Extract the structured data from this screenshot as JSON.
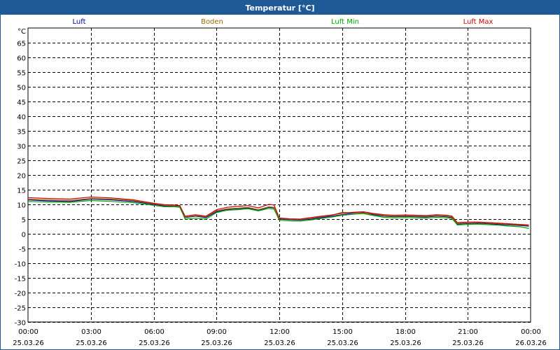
{
  "window": {
    "title": "Temperatur [°C]"
  },
  "colors": {
    "header_bg": "#1f5a96",
    "grid": "#000000",
    "luft": "#000099",
    "boden": "#996600",
    "luft_min": "#00aa00",
    "luft_max": "#cc0000"
  },
  "chart_data": {
    "type": "line",
    "title": "Temperatur [°C]",
    "ylabel": "°C",
    "ylim": [
      -30,
      70
    ],
    "yticks": [
      -30,
      -25,
      -20,
      -15,
      -10,
      -5,
      0,
      5,
      10,
      15,
      20,
      25,
      30,
      35,
      40,
      45,
      50,
      55,
      60,
      65
    ],
    "xlim": [
      "2026-03-25 00:00",
      "2026-03-26 00:00"
    ],
    "xticks": [
      {
        "time": "00:00",
        "date": "25.03.26"
      },
      {
        "time": "03:00",
        "date": "25.03.26"
      },
      {
        "time": "06:00",
        "date": "25.03.26"
      },
      {
        "time": "09:00",
        "date": "25.03.26"
      },
      {
        "time": "12:00",
        "date": "25.03.26"
      },
      {
        "time": "15:00",
        "date": "25.03.26"
      },
      {
        "time": "18:00",
        "date": "25.03.26"
      },
      {
        "time": "21:00",
        "date": "25.03.26"
      },
      {
        "time": "00:00",
        "date": "26.03.26"
      }
    ],
    "grid": true,
    "legend_position": "top",
    "series": [
      {
        "name": "Luft",
        "color": "#000099",
        "x": [
          "00:00",
          "01:00",
          "02:00",
          "03:00",
          "04:00",
          "05:00",
          "06:00",
          "06:30",
          "07:00",
          "07:15",
          "07:30",
          "08:00",
          "08:30",
          "09:00",
          "09:30",
          "10:00",
          "10:30",
          "11:00",
          "11:30",
          "11:45",
          "12:00",
          "12:30",
          "13:00",
          "13:30",
          "14:00",
          "14:30",
          "15:00",
          "15:30",
          "16:00",
          "16:30",
          "17:00",
          "17:30",
          "18:00",
          "18:30",
          "19:00",
          "19:30",
          "20:00",
          "20:15",
          "20:30",
          "21:00",
          "21:30",
          "22:00",
          "22:30",
          "23:00",
          "23:30",
          "23:55"
        ],
        "y": [
          11.5,
          11.2,
          11.0,
          11.8,
          11.5,
          11.0,
          10.0,
          9.5,
          9.5,
          9.3,
          5.5,
          6.0,
          5.5,
          7.5,
          8.3,
          8.5,
          8.8,
          8.0,
          9.0,
          8.8,
          5.0,
          4.8,
          4.7,
          5.0,
          5.5,
          6.0,
          6.5,
          7.0,
          7.2,
          6.5,
          6.0,
          5.8,
          5.9,
          5.8,
          5.7,
          6.0,
          5.8,
          5.5,
          3.3,
          3.5,
          3.6,
          3.4,
          3.2,
          3.0,
          2.8,
          2.6
        ]
      },
      {
        "name": "Boden",
        "color": "#996600",
        "x": [
          "00:00",
          "01:00",
          "02:00",
          "03:00",
          "04:00",
          "05:00",
          "06:00",
          "06:30",
          "07:00",
          "07:15",
          "07:30",
          "08:00",
          "08:30",
          "09:00",
          "09:30",
          "10:00",
          "10:30",
          "11:00",
          "11:30",
          "11:45",
          "12:00",
          "12:30",
          "13:00",
          "13:30",
          "14:00",
          "14:30",
          "15:00",
          "15:30",
          "16:00",
          "16:30",
          "17:00",
          "17:30",
          "18:00",
          "18:30",
          "19:00",
          "19:30",
          "20:00",
          "20:15",
          "20:30",
          "21:00",
          "21:30",
          "22:00",
          "22:30",
          "23:00",
          "23:30",
          "23:55"
        ],
        "y": [
          11.8,
          11.5,
          11.3,
          12.0,
          11.8,
          11.3,
          10.2,
          9.7,
          9.6,
          9.4,
          5.7,
          6.2,
          5.8,
          7.8,
          8.5,
          8.7,
          9.0,
          8.2,
          9.2,
          9.0,
          5.2,
          5.0,
          4.9,
          5.2,
          5.8,
          6.3,
          7.3,
          7.2,
          7.0,
          6.8,
          6.2,
          6.0,
          6.1,
          6.0,
          5.9,
          6.2,
          6.0,
          5.7,
          3.5,
          3.7,
          3.8,
          3.6,
          3.4,
          3.2,
          3.0,
          2.8
        ]
      },
      {
        "name": "Luft Min",
        "color": "#00aa00",
        "x": [
          "00:00",
          "01:00",
          "02:00",
          "03:00",
          "04:00",
          "05:00",
          "06:00",
          "06:30",
          "07:00",
          "07:15",
          "07:30",
          "08:00",
          "08:30",
          "09:00",
          "09:30",
          "10:00",
          "10:30",
          "11:00",
          "11:30",
          "11:45",
          "12:00",
          "12:30",
          "13:00",
          "13:30",
          "14:00",
          "14:30",
          "15:00",
          "15:30",
          "16:00",
          "16:30",
          "17:00",
          "17:30",
          "18:00",
          "18:30",
          "19:00",
          "19:30",
          "20:00",
          "20:15",
          "20:30",
          "21:00",
          "21:30",
          "22:00",
          "22:30",
          "23:00",
          "23:30",
          "23:55"
        ],
        "y": [
          11.0,
          10.8,
          10.7,
          11.3,
          11.0,
          10.6,
          9.7,
          9.2,
          9.2,
          9.0,
          5.0,
          5.3,
          5.0,
          7.2,
          8.0,
          8.2,
          8.5,
          7.8,
          8.6,
          8.4,
          4.6,
          4.4,
          4.3,
          4.7,
          5.2,
          5.7,
          6.3,
          6.6,
          6.9,
          6.2,
          5.6,
          5.4,
          5.5,
          5.4,
          5.3,
          5.6,
          5.4,
          5.2,
          3.0,
          3.2,
          3.3,
          3.1,
          2.9,
          2.6,
          2.4,
          1.8
        ]
      },
      {
        "name": "Luft Max",
        "color": "#cc0000",
        "x": [
          "00:00",
          "01:00",
          "02:00",
          "03:00",
          "04:00",
          "05:00",
          "06:00",
          "06:30",
          "07:00",
          "07:15",
          "07:30",
          "08:00",
          "08:30",
          "09:00",
          "09:30",
          "10:00",
          "10:30",
          "11:00",
          "11:30",
          "11:45",
          "12:00",
          "12:30",
          "13:00",
          "13:30",
          "14:00",
          "14:30",
          "15:00",
          "15:30",
          "16:00",
          "16:30",
          "17:00",
          "17:30",
          "18:00",
          "18:30",
          "19:00",
          "19:30",
          "20:00",
          "20:15",
          "20:30",
          "21:00",
          "21:30",
          "22:00",
          "22:30",
          "23:00",
          "23:30",
          "23:55"
        ],
        "y": [
          12.3,
          12.0,
          11.8,
          12.5,
          12.2,
          11.6,
          10.4,
          9.9,
          9.8,
          9.6,
          6.0,
          6.5,
          6.0,
          8.2,
          9.0,
          9.3,
          9.6,
          8.8,
          10.0,
          9.8,
          5.4,
          5.1,
          5.0,
          5.5,
          6.0,
          6.4,
          7.0,
          7.3,
          7.5,
          6.9,
          6.5,
          6.3,
          6.4,
          6.3,
          6.2,
          6.5,
          6.3,
          6.0,
          3.8,
          4.0,
          4.0,
          3.8,
          3.6,
          3.4,
          3.2,
          3.0
        ]
      }
    ]
  }
}
